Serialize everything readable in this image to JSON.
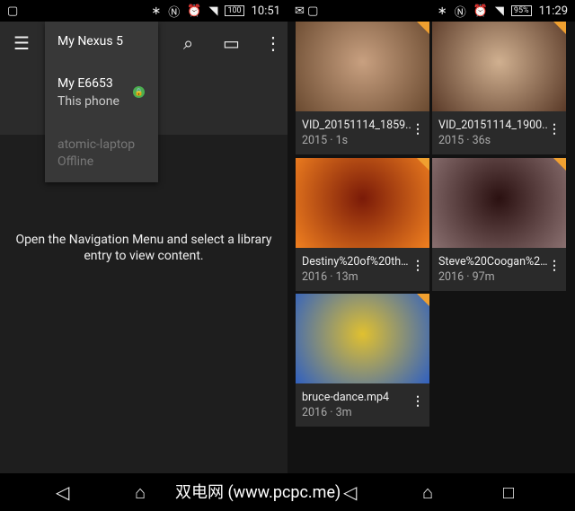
{
  "status_left": {
    "time": "10:51",
    "battery": "100"
  },
  "status_right": {
    "time": "11:29",
    "battery": "95%"
  },
  "left": {
    "devices": [
      {
        "name": "My Nexus 5"
      },
      {
        "name": "My E6653",
        "sub": "This phone"
      },
      {
        "name": "atomic-laptop",
        "sub": "Offline"
      }
    ],
    "message": "Open the Navigation Menu and select a library entry to view content."
  },
  "videos": [
    {
      "title": "VID_20151114_1859..",
      "meta": "2015 · 1s",
      "colors": [
        "#6a4a30",
        "#c8a080"
      ]
    },
    {
      "title": "VID_20151114_1900..",
      "meta": "2015 · 36s",
      "colors": [
        "#5a3a28",
        "#d0b090"
      ]
    },
    {
      "title": "Destiny%20of%20the..",
      "meta": "2016 · 13m",
      "colors": [
        "#f08020",
        "#7a1a08"
      ]
    },
    {
      "title": "Steve%20Coogan%20..",
      "meta": "2016 · 97m",
      "colors": [
        "#8a7070",
        "#2a1010"
      ]
    },
    {
      "title": "bruce-dance.mp4",
      "meta": "2016 · 3m",
      "colors": [
        "#3060c0",
        "#e0c030"
      ]
    }
  ],
  "watermark": "双电网 (www.pcpc.me)"
}
